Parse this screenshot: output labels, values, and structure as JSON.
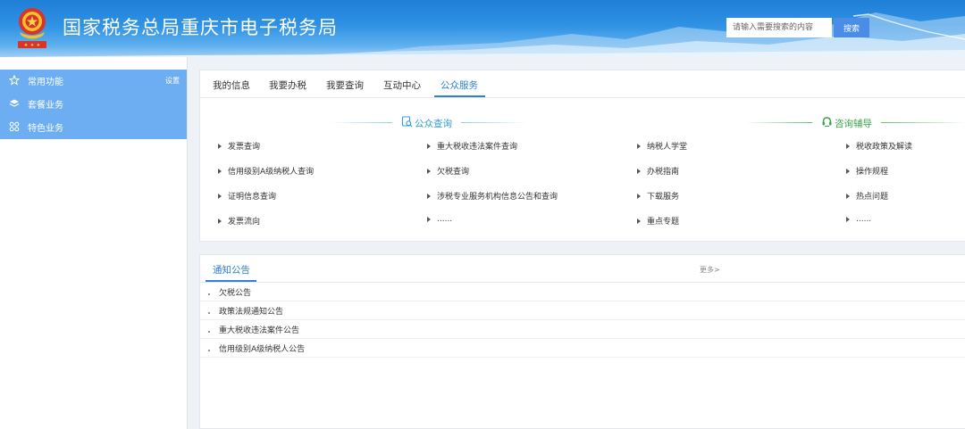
{
  "header": {
    "title": "国家税务总局重庆市电子税务局",
    "search_placeholder": "请输入需要搜索的内容",
    "search_button": "搜索",
    "colors": {
      "bg_top": "#1f7fd6",
      "button": "#4a8de6"
    }
  },
  "sidebar": {
    "items": [
      {
        "label": "常用功能",
        "icon": "star-icon",
        "action": "设置"
      },
      {
        "label": "套餐业务",
        "icon": "layers-icon"
      },
      {
        "label": "特色业务",
        "icon": "grid-icon"
      }
    ],
    "color": "#6daef2"
  },
  "tabs": [
    "我的信息",
    "我要办税",
    "我要查询",
    "互动中心",
    "公众服务"
  ],
  "active_tab": "公众服务",
  "sections": {
    "public_query": {
      "title": "公众查询",
      "icon": "doc-search-icon",
      "links_col1": [
        "发票查询",
        "信用级别A级纳税人查询",
        "证明信息查询",
        "发票流向"
      ],
      "links_col2": [
        "重大税收违法案件查询",
        "欠税查询",
        "涉税专业服务机构信息公告和查询",
        "......"
      ]
    },
    "consult": {
      "title": "咨询辅导",
      "icon": "support-icon",
      "links_col1": [
        "纳税人学堂",
        "办税指南",
        "下载服务",
        "重点专题"
      ],
      "links_col2": [
        "税收政策及解读",
        "操作规程",
        "热点问题",
        "......"
      ]
    }
  },
  "notices": {
    "tab": "通知公告",
    "more": "更多>",
    "items": [
      "欠税公告",
      "政策法规通知公告",
      "重大税收违法案件公告",
      "信用级别A级纳税人公告"
    ]
  }
}
